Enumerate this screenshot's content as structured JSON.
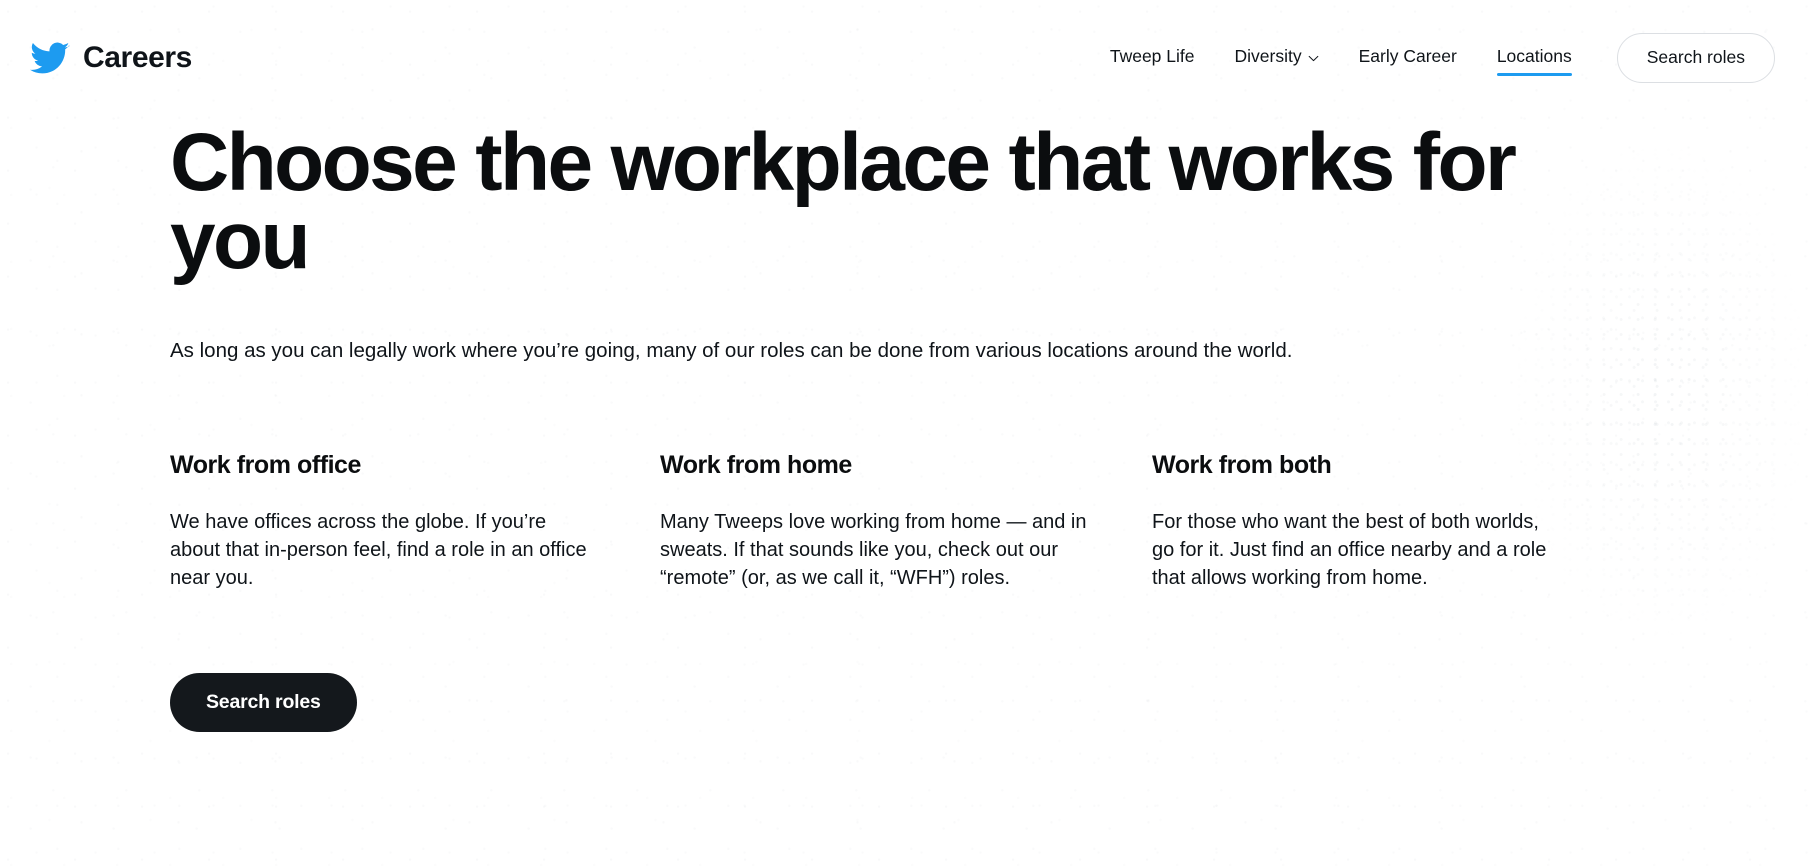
{
  "colors": {
    "brand_blue": "#1D9BF0",
    "text": "#0F1419",
    "cta_background": "#14181C",
    "cta_text": "#FFFFFF",
    "nav_border": "#DCDFE3"
  },
  "header": {
    "logo_icon": "twitter-bird-icon",
    "brand_name": "Careers",
    "nav_items": [
      {
        "label": "Tweep Life",
        "active": false,
        "has_chevron": false
      },
      {
        "label": "Diversity",
        "active": false,
        "has_chevron": true,
        "chevron_icon": "chevron-down-icon"
      },
      {
        "label": "Early Career",
        "active": false,
        "has_chevron": false
      },
      {
        "label": "Locations",
        "active": true,
        "has_chevron": false
      }
    ],
    "cta_label": "Search roles"
  },
  "hero": {
    "title": "Choose the workplace that works for you",
    "subtitle": "As long as you can legally work where you’re going, many of our roles can be done from various locations around the world."
  },
  "columns": [
    {
      "title": "Work from office",
      "body": "We have offices across the globe. If you’re about that in-person feel, find a role in an office near you."
    },
    {
      "title": "Work from home",
      "body": "Many Tweeps love working from home — and in sweats. If that sounds like you, check out our “remote” (or, as we call it, “WFH”) roles."
    },
    {
      "title": "Work from both",
      "body": "For those who want the best of both worlds, go for it. Just find an office nearby and a role that allows working from home."
    }
  ],
  "cta": {
    "label": "Search roles"
  }
}
